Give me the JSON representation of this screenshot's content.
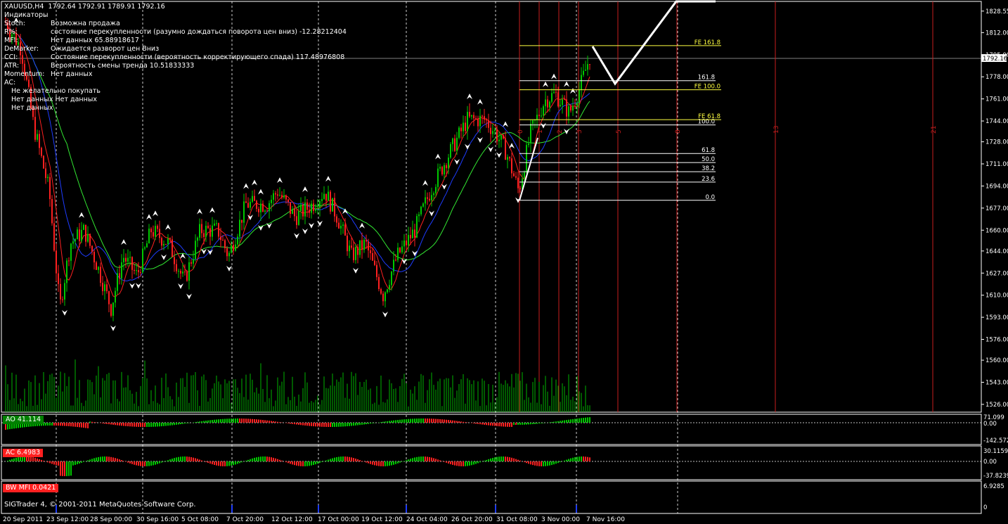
{
  "window": {
    "title": "XAUUSD,H4",
    "ohlc": "1792.64 1792.91 1789.91 1792.16"
  },
  "info_panel": {
    "heading": "Индикаторы",
    "rows": [
      {
        "k": "Stoch:",
        "v": "Возможна продажа"
      },
      {
        "k": "R%:",
        "v": " состояние перекупленности (разумно дождаться поворота цен вниз) -12.28212404"
      },
      {
        "k": "MFI:",
        "v": "Нет данных 65.88918617"
      },
      {
        "k": "DeMarker:",
        "v": "Ожидается разворот  цен Вниз"
      },
      {
        "k": "CCI:",
        "v": "Состояние перекупленности (вероятность корректирующего спада) 117.48976808"
      },
      {
        "k": "ATR:",
        "v": "Вероятность смены тренда 10.51833333"
      },
      {
        "k": "Momentum:",
        "v": "Нет данных"
      },
      {
        "k": "AC:",
        "v": ""
      }
    ],
    "extra": [
      "Не желательно покупать",
      "Нет данных Нет данных",
      "Нет данных"
    ]
  },
  "copyright": "SIGTrader 4, © 2001-2011 MetaQuotes Software Corp.",
  "colors": {
    "bull": "#00c800",
    "bear": "#ff2020",
    "ma_fast": "#ff2020",
    "ma_mid": "#1e3cff",
    "ma_slow": "#32e632",
    "fib": "#ffffff",
    "fe": "#ffff40",
    "time_zone": "#c81e1e"
  },
  "chart_data": [
    {
      "type": "candlestick",
      "title": "XAUUSD,H4",
      "ylim": [
        1520,
        1836
      ],
      "y_ticks": [
        "1828.55",
        "1812.00",
        "1795.00",
        "1778.00",
        "1761.00",
        "1744.00",
        "1728.00",
        "1711.00",
        "1694.00",
        "1677.00",
        "1660.00",
        "1644.00",
        "1627.00",
        "1610.00",
        "1593.00",
        "1576.00",
        "1560.00",
        "1543.00",
        "1526.00"
      ],
      "current_price": "1792.16",
      "x_ticks": [
        "20 Sep 2011",
        "23 Sep 12:00",
        "28 Sep 00:00",
        "30 Sep 16:00",
        "5 Oct 08:00",
        "7 Oct 20:00",
        "12 Oct 12:00",
        "17 Oct 00:00",
        "19 Oct 12:00",
        "24 Oct 04:00",
        "26 Oct 20:00",
        "31 Oct 08:00",
        "3 Nov 00:00",
        "7 Nov 16:00"
      ],
      "fib_retracement": [
        {
          "label": "161.8",
          "value": 1775
        },
        {
          "label": "100.0",
          "value": 1741
        },
        {
          "label": "61.8",
          "value": 1719
        },
        {
          "label": "50.0",
          "value": 1712
        },
        {
          "label": "38.2",
          "value": 1705
        },
        {
          "label": "23.6",
          "value": 1697
        },
        {
          "label": "0.0",
          "value": 1683
        }
      ],
      "fib_expansion": [
        {
          "label": "FE 161.8",
          "value": 1802
        },
        {
          "label": "FE 100.0",
          "value": 1768
        },
        {
          "label": "FE 61.8",
          "value": 1745
        }
      ],
      "time_zones": [
        "0",
        "1",
        "2",
        "3",
        "5",
        "8",
        "13",
        "21"
      ]
    },
    {
      "type": "bar",
      "title": "AO 41.114",
      "y_ticks": [
        "71.099",
        "0.00",
        "-142.572"
      ]
    },
    {
      "type": "bar",
      "title": "AC 6.4983",
      "y_ticks": [
        "30.1159",
        "0.00",
        "-37.8239"
      ]
    },
    {
      "type": "bar",
      "title": "BW MFI 0.0421",
      "y_ticks": [
        "6.9285",
        "0"
      ]
    }
  ]
}
